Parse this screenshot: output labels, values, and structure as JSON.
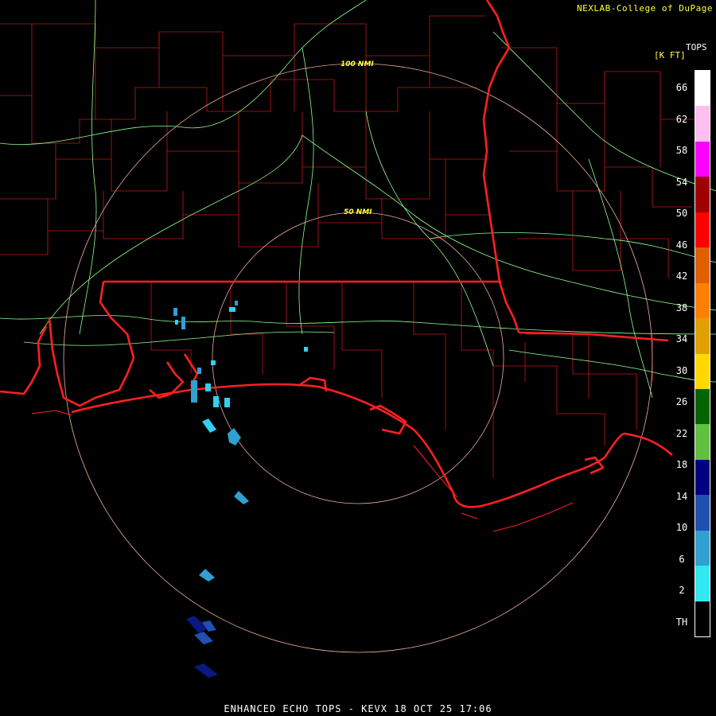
{
  "header": {
    "credit": "NEXLAB-College of DuPage",
    "legend_title": "TOPS",
    "legend_units": "[K FT]"
  },
  "footer": {
    "product": "ENHANCED ECHO TOPS - KEVX 18 OCT 25 17:06"
  },
  "range_rings": [
    {
      "label": "50 NMI"
    },
    {
      "label": "100 NMI"
    }
  ],
  "legend": {
    "labels": [
      "66",
      "62",
      "58",
      "54",
      "50",
      "46",
      "42",
      "38",
      "34",
      "30",
      "26",
      "22",
      "18",
      "14",
      "10",
      "6",
      "2",
      "TH"
    ],
    "colors": [
      "#ffffff",
      "#ffffff",
      "#ffc0f0",
      "#ffc0f0",
      "#ff00ff",
      "#ff00ff",
      "#a00000",
      "#a00000",
      "#ff0000",
      "#ff0000",
      "#e06000",
      "#e06000",
      "#ff8000",
      "#ff8000",
      "#e0a000",
      "#e0a000",
      "#ffd800",
      "#ffd800",
      "#006400",
      "#006400",
      "#60c040",
      "#60c040",
      "#000080",
      "#000080",
      "#2050b0",
      "#2050b0",
      "#30a0d0",
      "#30a0d0",
      "#30e8f0",
      "#30e8f0",
      "#000000",
      "#000000"
    ]
  },
  "palette": {
    "state_border": "#ff2020",
    "county_border": "#c01818",
    "highway": "#90ff90",
    "ring": "#f0b0a0",
    "echo_light": "#30d0f0",
    "echo_mid": "#30a0d0",
    "echo_dark": "#0a1880"
  }
}
